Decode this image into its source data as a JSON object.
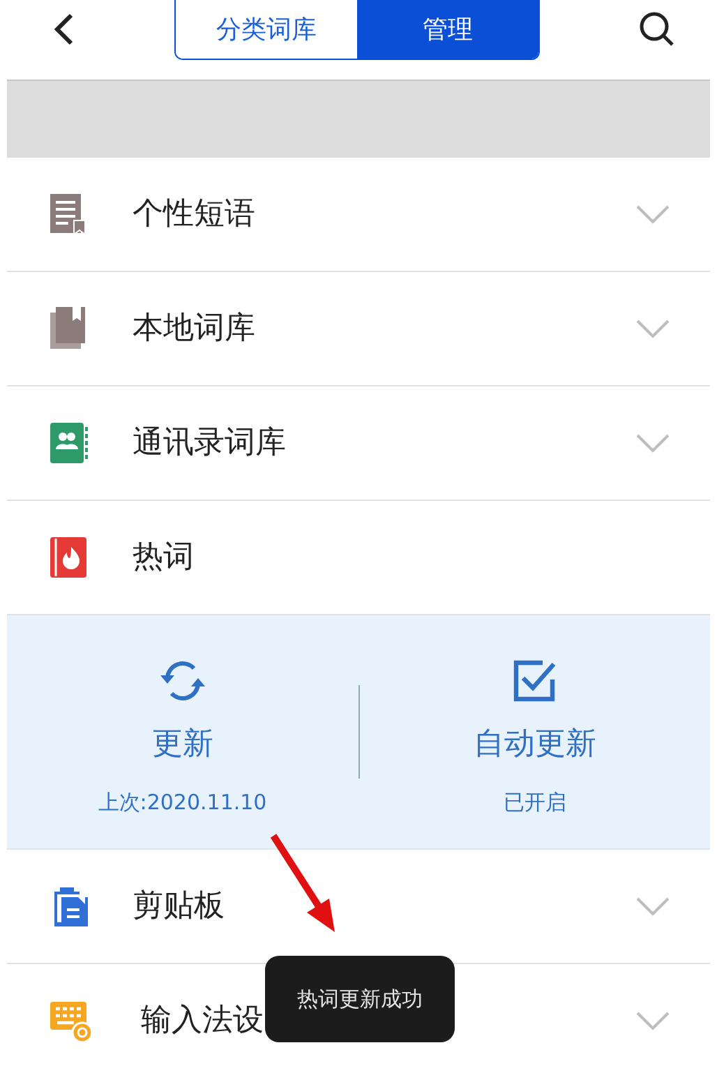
{
  "header": {
    "tabs": [
      {
        "label": "分类词库",
        "selected": false
      },
      {
        "label": "管理",
        "selected": true
      }
    ]
  },
  "items": [
    {
      "label": "个性短语",
      "color": "#8c7b7b",
      "expanded": false
    },
    {
      "label": "本地词库",
      "color": "#8c7b7b",
      "expanded": false
    },
    {
      "label": "通讯录词库",
      "color": "#2e9a6a",
      "expanded": false
    },
    {
      "label": "热词",
      "color": "#e53935",
      "expanded": true,
      "actions": [
        {
          "kind": "refresh",
          "label": "更新",
          "caption": "上次:2020.11.10"
        },
        {
          "kind": "toggle",
          "label": "自动更新",
          "caption": "已开启",
          "checked": true
        }
      ]
    },
    {
      "label": "剪贴板",
      "color": "#2f6fd6",
      "expanded": false
    },
    {
      "label": "输入法设",
      "color": "#f5a623",
      "expanded": false
    }
  ],
  "toast": {
    "text": "热词更新成功"
  }
}
